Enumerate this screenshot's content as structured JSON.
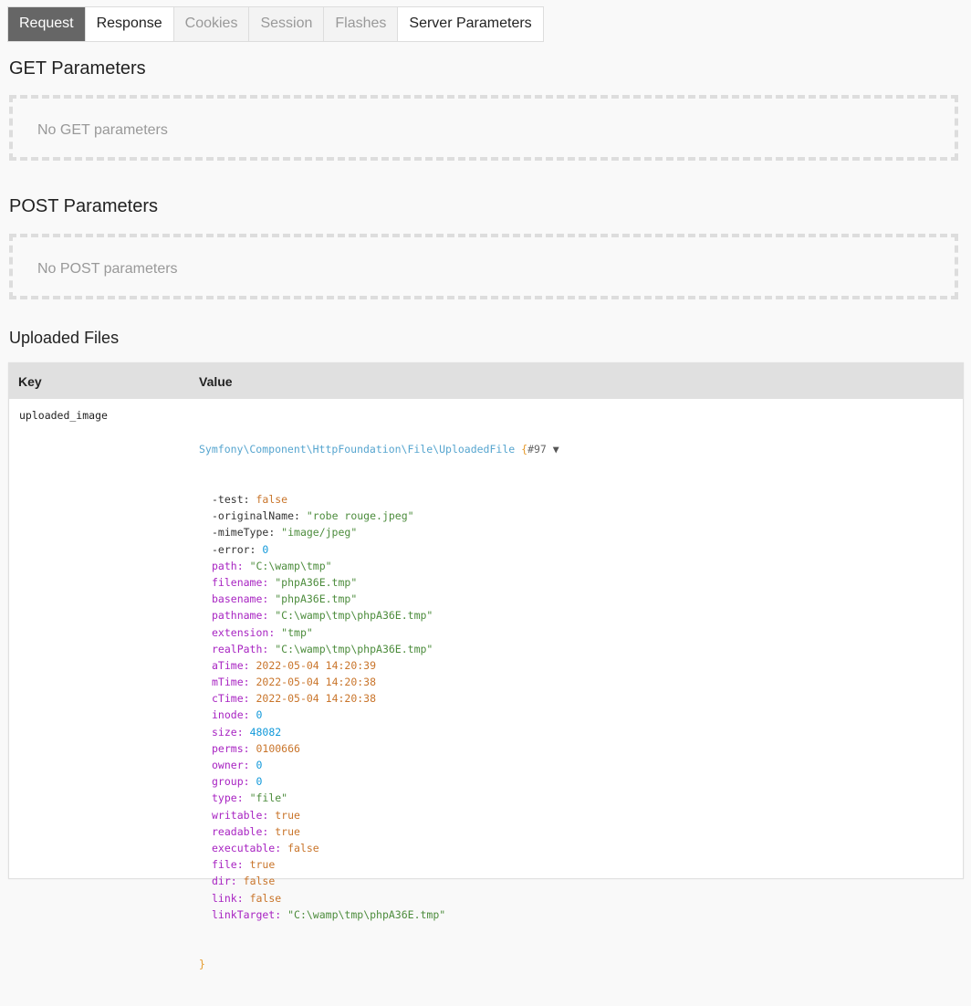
{
  "tabs": [
    {
      "label": "Request",
      "state": "active"
    },
    {
      "label": "Response",
      "state": "normal"
    },
    {
      "label": "Cookies",
      "state": "disabled"
    },
    {
      "label": "Session",
      "state": "disabled"
    },
    {
      "label": "Flashes",
      "state": "disabled"
    },
    {
      "label": "Server Parameters",
      "state": "normal"
    }
  ],
  "get_section": {
    "title": "GET Parameters",
    "empty_text": "No GET parameters"
  },
  "post_section": {
    "title": "POST Parameters",
    "empty_text": "No POST parameters"
  },
  "files_section": {
    "title": "Uploaded Files",
    "columns": {
      "key": "Key",
      "value": "Value"
    },
    "rows": [
      {
        "key": "uploaded_image",
        "class_name": "Symfony\\Component\\HttpFoundation\\File\\UploadedFile",
        "open_brace": "{",
        "ref": "#97",
        "toggle_icon": "▼",
        "close_brace": "}",
        "properties": [
          {
            "name": "-test",
            "vis": "priv",
            "value": "false",
            "type": "const"
          },
          {
            "name": "-originalName",
            "vis": "priv",
            "value": "\"robe rouge.jpeg\"",
            "type": "str"
          },
          {
            "name": "-mimeType",
            "vis": "priv",
            "value": "\"image/jpeg\"",
            "type": "str"
          },
          {
            "name": "-error",
            "vis": "priv",
            "value": "0",
            "type": "num"
          },
          {
            "name": "path",
            "vis": "pub",
            "value": "\"C:\\wamp\\tmp\"",
            "type": "str"
          },
          {
            "name": "filename",
            "vis": "pub",
            "value": "\"phpA36E.tmp\"",
            "type": "str"
          },
          {
            "name": "basename",
            "vis": "pub",
            "value": "\"phpA36E.tmp\"",
            "type": "str"
          },
          {
            "name": "pathname",
            "vis": "pub",
            "value": "\"C:\\wamp\\tmp\\phpA36E.tmp\"",
            "type": "str"
          },
          {
            "name": "extension",
            "vis": "pub",
            "value": "\"tmp\"",
            "type": "str"
          },
          {
            "name": "realPath",
            "vis": "pub",
            "value": "\"C:\\wamp\\tmp\\phpA36E.tmp\"",
            "type": "str"
          },
          {
            "name": "aTime",
            "vis": "pub",
            "value": "2022-05-04 14:20:39",
            "type": "const"
          },
          {
            "name": "mTime",
            "vis": "pub",
            "value": "2022-05-04 14:20:38",
            "type": "const"
          },
          {
            "name": "cTime",
            "vis": "pub",
            "value": "2022-05-04 14:20:38",
            "type": "const"
          },
          {
            "name": "inode",
            "vis": "pub",
            "value": "0",
            "type": "num"
          },
          {
            "name": "size",
            "vis": "pub",
            "value": "48082",
            "type": "num"
          },
          {
            "name": "perms",
            "vis": "pub",
            "value": "0100666",
            "type": "const"
          },
          {
            "name": "owner",
            "vis": "pub",
            "value": "0",
            "type": "num"
          },
          {
            "name": "group",
            "vis": "pub",
            "value": "0",
            "type": "num"
          },
          {
            "name": "type",
            "vis": "pub",
            "value": "\"file\"",
            "type": "str"
          },
          {
            "name": "writable",
            "vis": "pub",
            "value": "true",
            "type": "const"
          },
          {
            "name": "readable",
            "vis": "pub",
            "value": "true",
            "type": "const"
          },
          {
            "name": "executable",
            "vis": "pub",
            "value": "false",
            "type": "const"
          },
          {
            "name": "file",
            "vis": "pub",
            "value": "true",
            "type": "const"
          },
          {
            "name": "dir",
            "vis": "pub",
            "value": "false",
            "type": "const"
          },
          {
            "name": "link",
            "vis": "pub",
            "value": "false",
            "type": "const"
          },
          {
            "name": "linkTarget",
            "vis": "pub",
            "value": "\"C:\\wamp\\tmp\\phpA36E.tmp\"",
            "type": "str"
          }
        ]
      }
    ]
  },
  "colors": {
    "active_tab_bg": "#666666",
    "class_name": "#56a5cf",
    "string": "#4c8c3c",
    "const": "#c9752b",
    "number": "#1299da",
    "public_prop": "#a824c2"
  }
}
